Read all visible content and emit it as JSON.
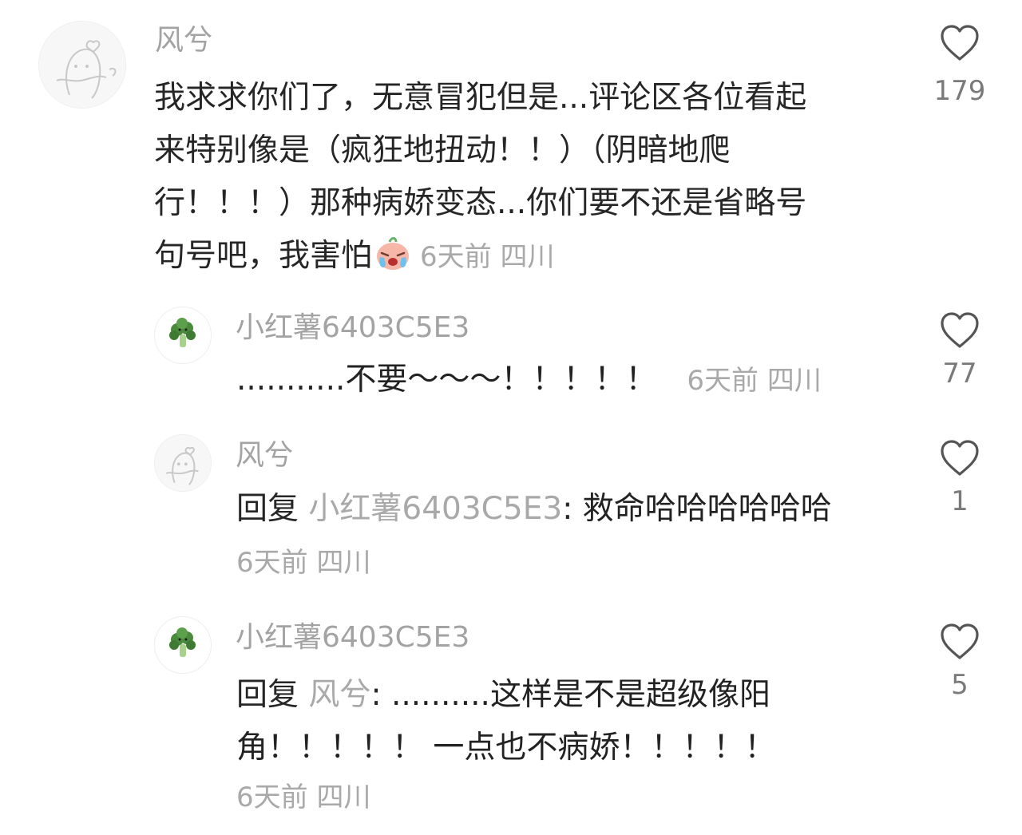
{
  "comments": [
    {
      "username": "风兮",
      "lines": [
        "我求求你们了，无意冒犯但是...评论区各位看起",
        "来特别像是（疯狂地扭动！！）（阴暗地爬",
        "行！！！）那种病娇变态...你们要不还是省略号",
        "句号吧，我害怕"
      ],
      "emoji": "crying-face-emoji",
      "time": "6天前",
      "location": "四川",
      "like_count": "179"
    },
    {
      "username": "小红薯6403C5E3",
      "text": "...........不要～～～！！！！！",
      "time": "6天前",
      "location": "四川",
      "like_count": "77"
    },
    {
      "username": "风兮",
      "reply_prefix": "回复",
      "reply_to": "小红薯6403C5E3",
      "text": "救命哈哈哈哈哈哈",
      "time": "6天前",
      "location": "四川",
      "like_count": "1"
    },
    {
      "username": "小红薯6403C5E3",
      "reply_prefix": "回复",
      "reply_to": "风兮",
      "lines": [
        "..........这样是不是超级像阳",
        "角！！！！！ 一点也不病娇！！！！！"
      ],
      "time": "6天前",
      "location": "四川",
      "like_count": "5"
    }
  ],
  "icons": {
    "like": "heart-outline-icon",
    "avatar_1": "cartoon-character-avatar",
    "avatar_2": "broccoli-avatar"
  },
  "colors": {
    "username": "#a3a3a3",
    "body": "#262626",
    "meta": "#a9a9a9",
    "like_count": "#7a7a7a"
  }
}
